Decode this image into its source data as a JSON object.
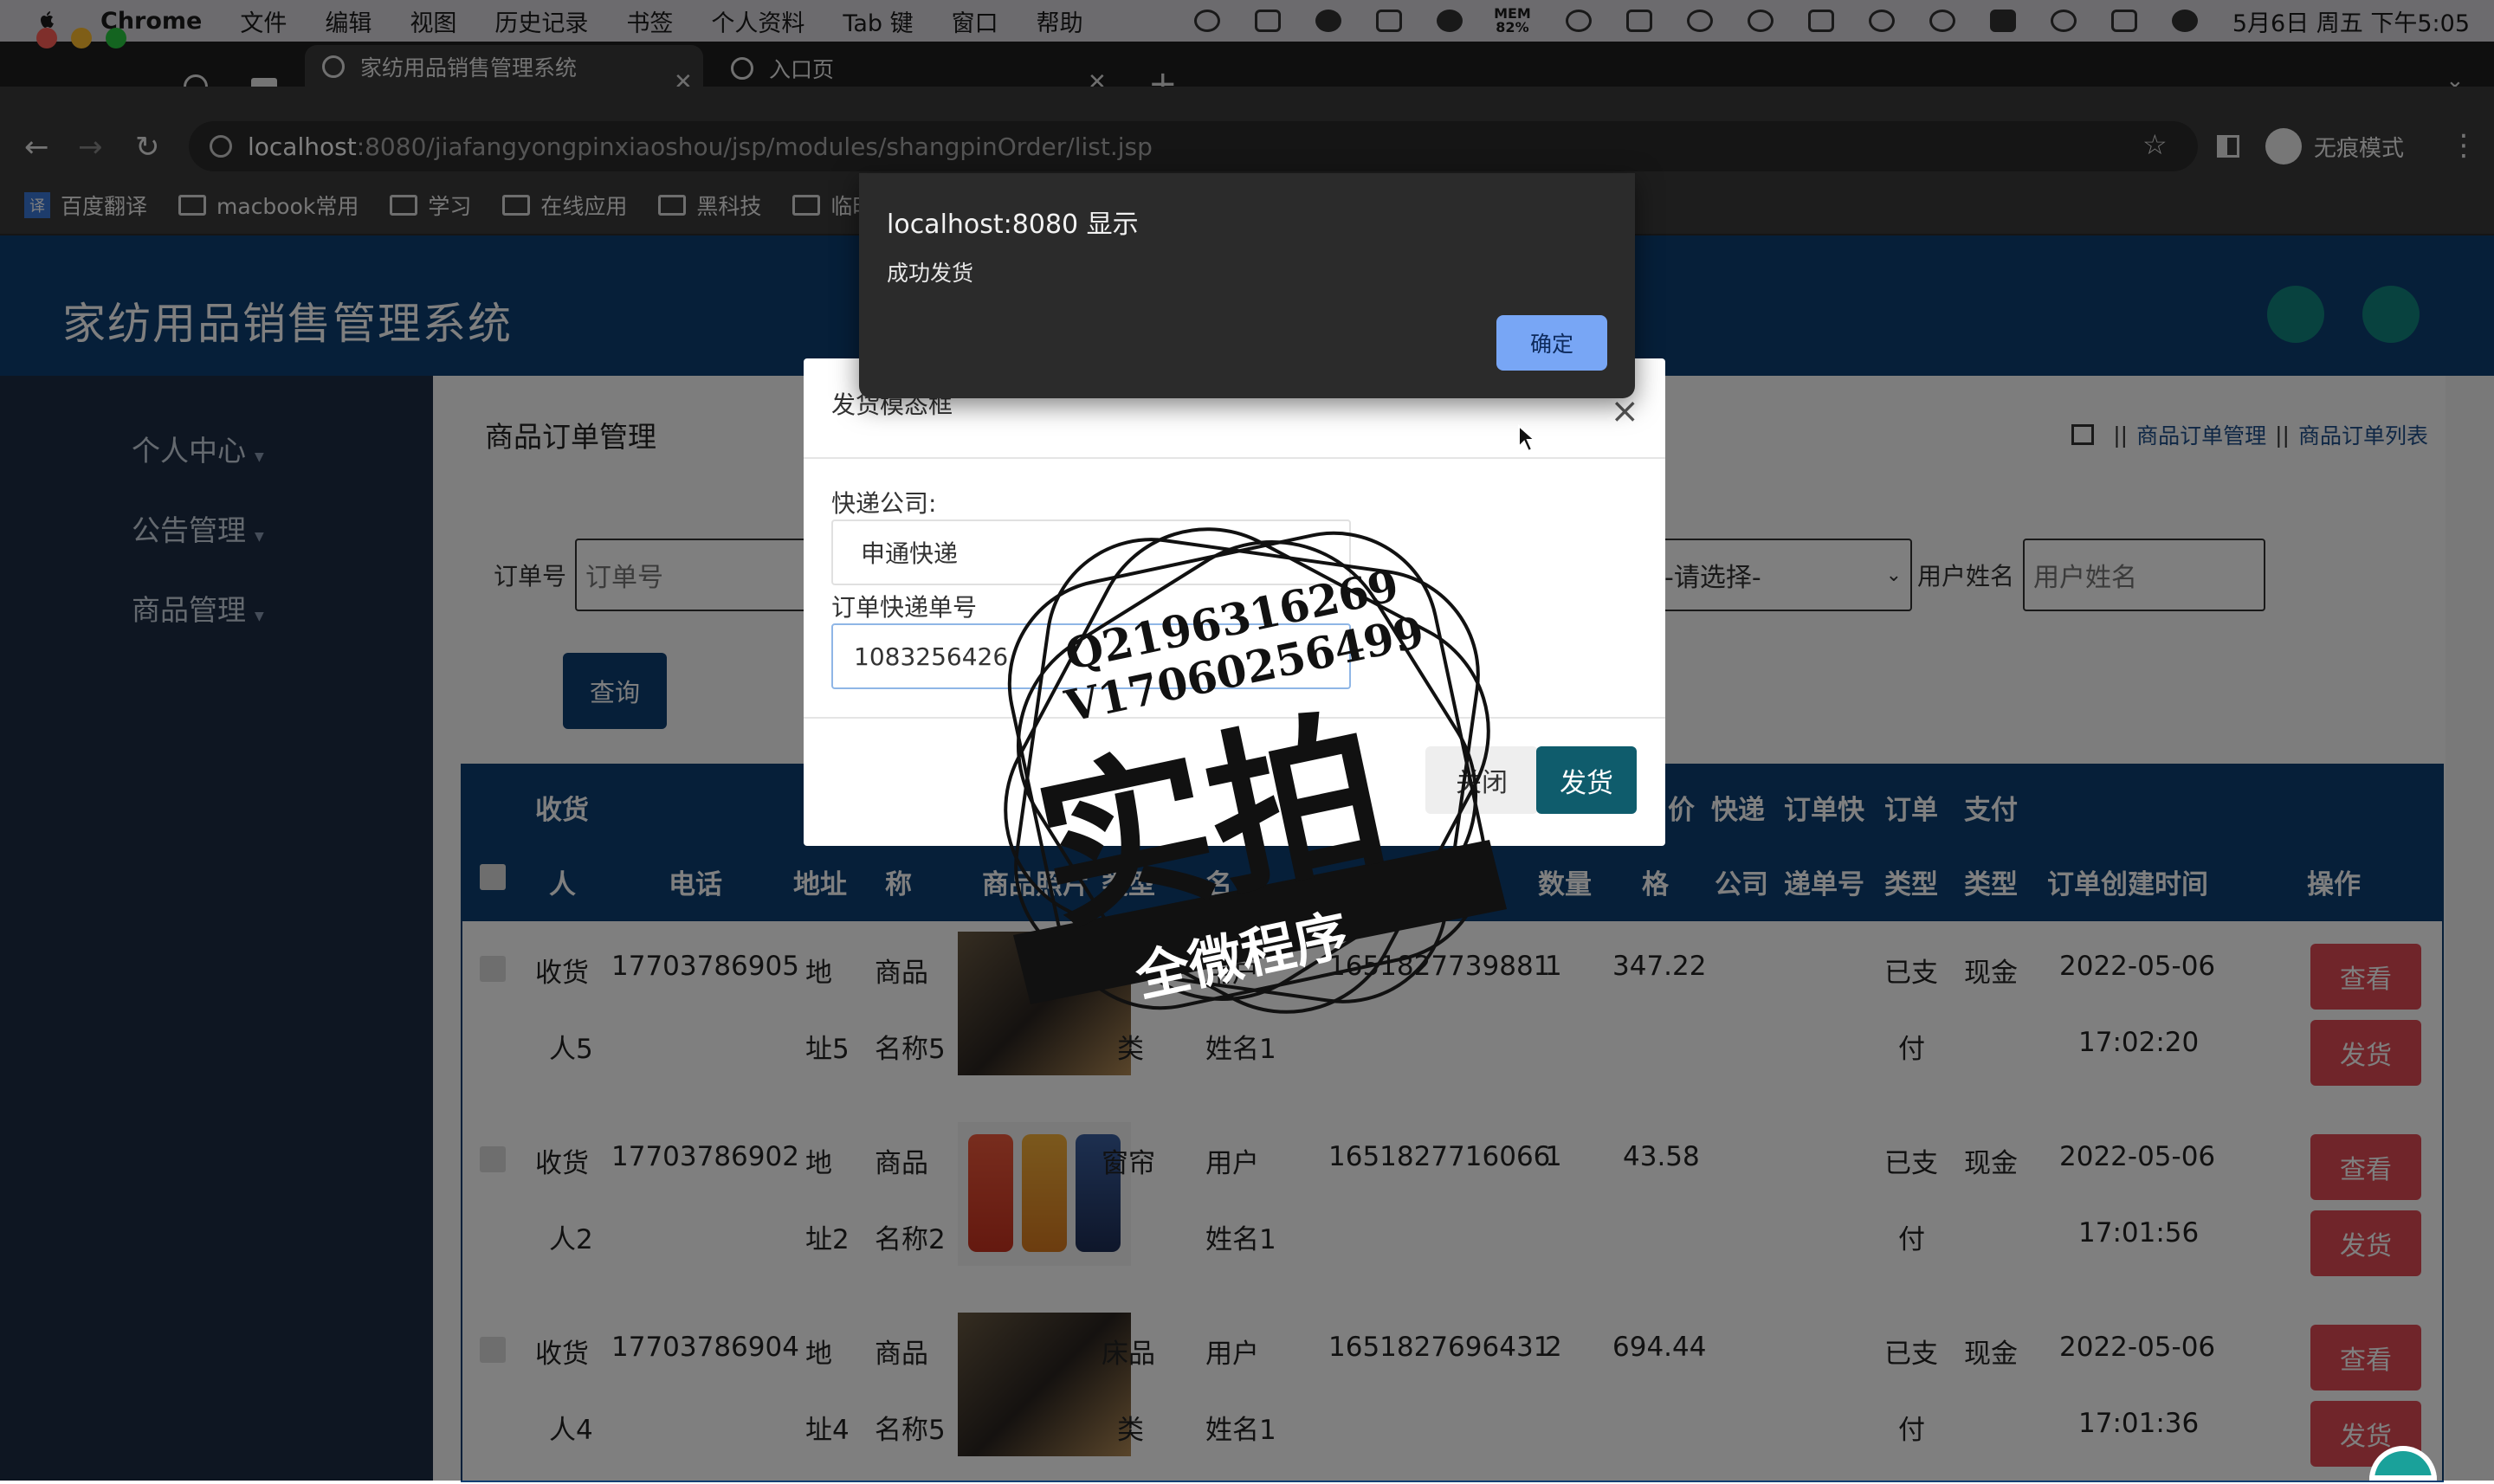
{
  "menubar": {
    "app": "Chrome",
    "items": [
      "文件",
      "编辑",
      "视图",
      "历史记录",
      "书签",
      "个人资料",
      "Tab 键",
      "窗口",
      "帮助"
    ],
    "mem_label": "MEM",
    "mem_value": "82%",
    "clock": "5月6日 周五 下午5:05"
  },
  "tabs": [
    {
      "label": "家纺用品销售管理系统",
      "active": true
    },
    {
      "label": "入口页",
      "active": false
    }
  ],
  "addressbar": {
    "host": "localhost",
    "path": ":8080/jiafangyongpinxiaoshou/jsp/modules/shangpinOrder/list.jsp",
    "profile": "无痕模式"
  },
  "bookmarks": [
    "百度翻译",
    "macbook常用",
    "学习",
    "在线应用",
    "黑科技",
    "临时"
  ],
  "header": {
    "system_title": "家纺用品销售管理系统"
  },
  "sidebar": {
    "items": [
      "个人中心",
      "公告管理",
      "商品管理"
    ]
  },
  "content": {
    "page_title": "商品订单管理",
    "breadcrumb": [
      "商品订单管理",
      "商品订单列表"
    ],
    "breadcrumb_sep": "||",
    "filters": {
      "order_no_label": "订单号",
      "order_no_placeholder": "订单号",
      "select_value": "-请选择-",
      "username_label": "用户姓名",
      "username_placeholder": "用户姓名"
    },
    "query_button": "查询"
  },
  "table": {
    "headers_top": [
      "收货",
      "价",
      "快递",
      "订单快",
      "订单",
      "支付"
    ],
    "headers_bottom": [
      "人",
      "电话",
      "地址",
      "称",
      "商品照片",
      "类型",
      "名",
      "单号",
      "数量",
      "格",
      "公司",
      "递单号",
      "类型",
      "类型",
      "订单创建时间",
      "操作"
    ],
    "rows": [
      {
        "name": [
          "收货",
          "人5"
        ],
        "phone": "17703786905",
        "addr": [
          "地",
          "址5"
        ],
        "product": [
          "商品",
          "名称5"
        ],
        "type": [
          "",
          "类"
        ],
        "user": [
          "用户",
          "姓名1"
        ],
        "order_no": "1651827739881",
        "qty": "1",
        "price": "347.22",
        "status": [
          "已支",
          "付"
        ],
        "pay": "现金",
        "time": [
          "2022-05-06",
          "17:02:20"
        ],
        "thumb": "dark"
      },
      {
        "name": [
          "收货",
          "人2"
        ],
        "phone": "17703786902",
        "addr": [
          "地",
          "址2"
        ],
        "product": [
          "商品",
          "名称2"
        ],
        "type": [
          "窗帘",
          ""
        ],
        "user": [
          "用户",
          "姓名1"
        ],
        "order_no": "1651827716066",
        "qty": "1",
        "price": "43.58",
        "status": [
          "已支",
          "付"
        ],
        "pay": "现金",
        "time": [
          "2022-05-06",
          "17:01:56"
        ],
        "thumb": "phones"
      },
      {
        "name": [
          "收货",
          "人4"
        ],
        "phone": "17703786904",
        "addr": [
          "地",
          "址4"
        ],
        "product": [
          "商品",
          "名称5"
        ],
        "type": [
          "床品",
          "类"
        ],
        "user": [
          "用户",
          "姓名1"
        ],
        "order_no": "1651827696431",
        "qty": "2",
        "price": "694.44",
        "status": [
          "已支",
          "付"
        ],
        "pay": "现金",
        "time": [
          "2022-05-06",
          "17:01:36"
        ],
        "thumb": "dark"
      }
    ],
    "btn_view": "查看",
    "btn_ship": "发货"
  },
  "modal": {
    "title": "发货模态框",
    "close_symbol": "×",
    "courier_label": "快递公司:",
    "courier_value": "申通快递",
    "tracking_label": "订单快递单号",
    "tracking_value": "1083256426",
    "btn_close": "关闭",
    "btn_ship": "发货"
  },
  "alert": {
    "title": "localhost:8080 显示",
    "message": "成功发货",
    "ok": "确定"
  },
  "watermark": {
    "line1": "Q2196316269",
    "line2": "V17060256499",
    "big": "实拍",
    "banner": "全微程序"
  },
  "colors": {
    "header": "#0d3e72",
    "sidebar": "#1c2d45",
    "danger": "#e14b54",
    "ship_button": "#0f5c6c",
    "alert_ok": "#78a6f5"
  }
}
